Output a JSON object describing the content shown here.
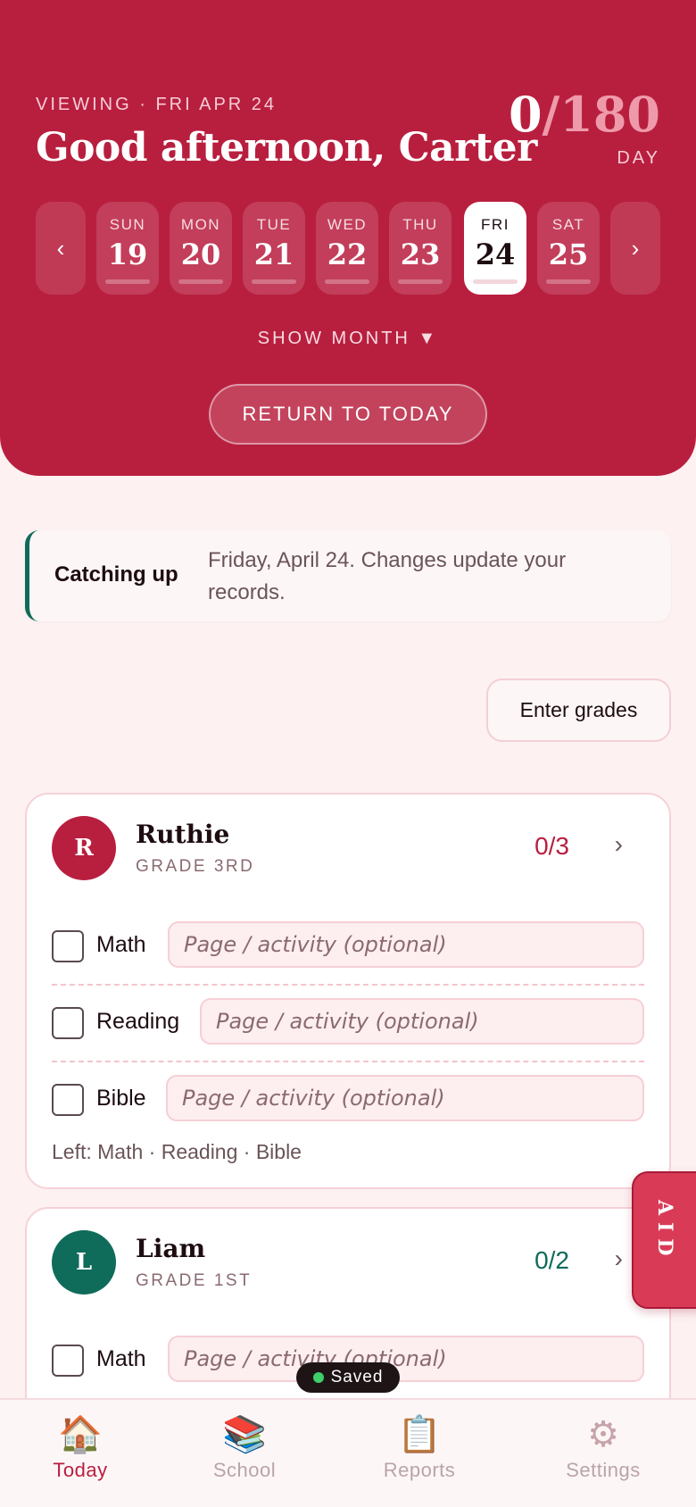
{
  "header": {
    "viewing_label": "VIEWING · FRI APR 24",
    "greeting": "Good afternoon, Carter",
    "day_current": "0",
    "day_total": "/180",
    "day_label": "DAY",
    "prev_glyph": "‹",
    "next_glyph": "›",
    "days": [
      {
        "name": "SUN",
        "num": "19"
      },
      {
        "name": "MON",
        "num": "20"
      },
      {
        "name": "TUE",
        "num": "21"
      },
      {
        "name": "WED",
        "num": "22"
      },
      {
        "name": "THU",
        "num": "23"
      },
      {
        "name": "FRI",
        "num": "24"
      },
      {
        "name": "SAT",
        "num": "25"
      }
    ],
    "selected_day": "FRI 24",
    "show_month": "SHOW MONTH ▼",
    "return_today": "RETURN TO TODAY",
    "colors": {
      "primary": "#b81f3f",
      "accent_green": "#0f6b5a"
    }
  },
  "banner": {
    "title": "Catching up",
    "text": "Friday, April 24. Changes update your records."
  },
  "enter_grades": "Enter grades",
  "students": [
    {
      "initial": "R",
      "name": "Ruthie",
      "grade": "GRADE 3RD",
      "progress": "0/3",
      "color": "#b81f3f",
      "subjects": [
        {
          "name": "Math",
          "placeholder": "Page / activity (optional)",
          "checked": false
        },
        {
          "name": "Reading",
          "placeholder": "Page / activity (optional)",
          "checked": false
        },
        {
          "name": "Bible",
          "placeholder": "Page / activity (optional)",
          "checked": false
        }
      ],
      "left_text": "Left: Math · Reading · Bible"
    },
    {
      "initial": "L",
      "name": "Liam",
      "grade": "GRADE 1ST",
      "progress": "0/2",
      "color": "#0f6b5a",
      "subjects": [
        {
          "name": "Math",
          "placeholder": "Page / activity (optional)",
          "checked": false
        }
      ]
    }
  ],
  "chevron": "›",
  "aid_tab": "AID",
  "saved_toast": "Saved",
  "bottom_nav": [
    {
      "icon": "house-icon",
      "glyph": "🏠",
      "label": "Today",
      "active": true
    },
    {
      "icon": "books-icon",
      "glyph": "📚",
      "label": "School",
      "active": false
    },
    {
      "icon": "clipboard-icon",
      "glyph": "📋",
      "label": "Reports",
      "active": false
    },
    {
      "icon": "gear-icon",
      "glyph": "⚙",
      "label": "Settings",
      "active": false
    }
  ]
}
